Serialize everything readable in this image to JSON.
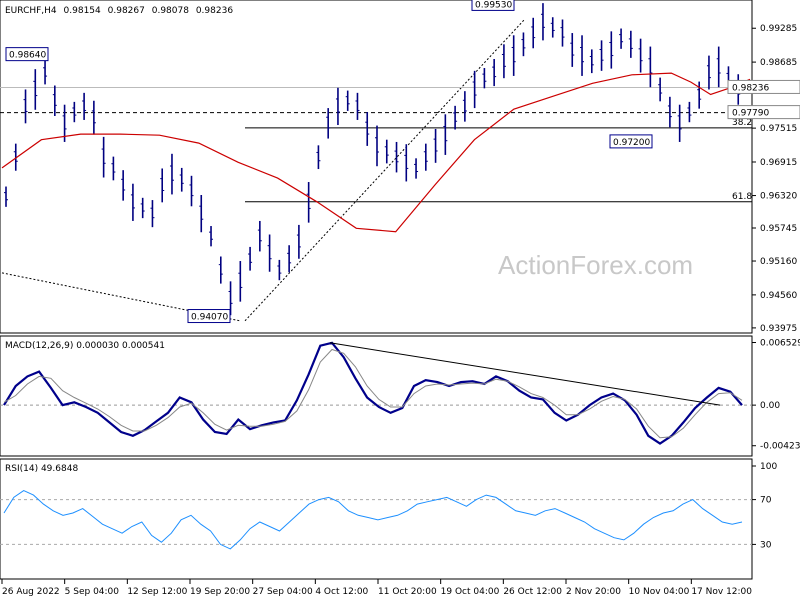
{
  "chart_data": [
    {
      "type": "line",
      "title": "EURCHF,H4",
      "ohlc": [
        "0.98154",
        "0.98267",
        "0.98078",
        "0.98236"
      ],
      "watermark": "ActionForex.com",
      "ylim": [
        0.9392,
        0.9975
      ],
      "yticks": [
        "0.99285",
        "0.98685",
        "0.98236",
        "0.97790",
        "0.97515",
        "0.96915",
        "0.96320",
        "0.95745",
        "0.95160",
        "0.94560",
        "0.93975"
      ],
      "ytick_values": [
        0.99285,
        0.98685,
        0.98236,
        0.9779,
        0.97515,
        0.96915,
        0.9632,
        0.95745,
        0.9516,
        0.9456,
        0.93975
      ],
      "current_price_label": "0.98236",
      "hline_label": "0.97790",
      "current_price": 0.98236,
      "hline_value": 0.9779,
      "fib_levels": [
        {
          "label": "38.2",
          "value": 0.9752
        },
        {
          "label": "61.8",
          "value": 0.9621
        }
      ],
      "annotations": [
        {
          "label": "0.98640",
          "value": 0.9864,
          "bar": 48
        },
        {
          "label": "0.99530",
          "value": 0.9953,
          "bar": 420
        },
        {
          "label": "0.94070",
          "value": 0.9407,
          "bar": 194
        },
        {
          "label": "0.97200",
          "value": 0.972,
          "bar": 538
        }
      ],
      "series": [
        {
          "name": "",
          "color": "#cc0000",
          "values": [
            0.9681,
            0.9731,
            0.9741,
            0.9741,
            0.9739,
            0.9725,
            0.9691,
            0.9663,
            0.9621,
            0.9574,
            0.9568,
            0.9651,
            0.9731,
            0.9785,
            0.9808,
            0.9831,
            0.9846,
            0.9849,
            0.9833,
            0.9811,
            0.9823,
            0.9838
          ]
        },
        {
          "name": "",
          "color": "#000000",
          "values": [
            0.9476,
            0.9407,
            0.9541,
            0.9586,
            0.9621,
            0.9666,
            0.9681,
            0.9701,
            0.9751,
            0.9795,
            0.9839,
            0.9885
          ]
        }
      ],
      "x": [
        0,
        40,
        80,
        120,
        160,
        200,
        240,
        280,
        320,
        360,
        400,
        440,
        480,
        520,
        560,
        600,
        640,
        680,
        700,
        720,
        740,
        760
      ],
      "candles": [
        0.963,
        0.97,
        0.979,
        0.982,
        0.985,
        0.98,
        0.976,
        0.978,
        0.979,
        0.977,
        0.97,
        0.968,
        0.965,
        0.962,
        0.961,
        0.96,
        0.965,
        0.967,
        0.966,
        0.964,
        0.96,
        0.956,
        0.95,
        0.945,
        0.948,
        0.952,
        0.956,
        0.953,
        0.95,
        0.952,
        0.955,
        0.962,
        0.97,
        0.976,
        0.979,
        0.98,
        0.979,
        0.975,
        0.972,
        0.971,
        0.97,
        0.969,
        0.968,
        0.97,
        0.972,
        0.974,
        0.977,
        0.979,
        0.982,
        0.984,
        0.985,
        0.987,
        0.988,
        0.99,
        0.992,
        0.994,
        0.993,
        0.992,
        0.989,
        0.988,
        0.987,
        0.988,
        0.989,
        0.991,
        0.99,
        0.988,
        0.986,
        0.982,
        0.978,
        0.976,
        0.978,
        0.981,
        0.985,
        0.986,
        0.984,
        0.982
      ]
    },
    {
      "type": "line",
      "title": "MACD(12,26,9) 0.000030 0.000541",
      "ylim": [
        -0.0052,
        0.007
      ],
      "yticks": [
        "0.006529",
        "0.00",
        "-0.004233"
      ],
      "ytick_values": [
        0.006529,
        0.0,
        -0.004233
      ],
      "series": [
        {
          "name": "",
          "color": "#00008b",
          "values": [
            0.0,
            0.002,
            0.003,
            0.0035,
            0.0018,
            0.0,
            0.0003,
            -0.0002,
            -0.0008,
            -0.0018,
            -0.0028,
            -0.0032,
            -0.0026,
            -0.0017,
            -0.0008,
            0.0008,
            0.0003,
            -0.0015,
            -0.0028,
            -0.003,
            -0.0015,
            -0.0025,
            -0.0021,
            -0.0018,
            -0.0016,
            0.0005,
            0.0032,
            0.0062,
            0.0065,
            0.005,
            0.0028,
            0.0008,
            -0.0002,
            -0.0008,
            -0.0003,
            0.002,
            0.0026,
            0.0024,
            0.002,
            0.0024,
            0.0025,
            0.0022,
            0.003,
            0.0025,
            0.0015,
            0.0008,
            0.0006,
            -0.0008,
            -0.0016,
            -0.001,
            0.0,
            0.0008,
            0.0012,
            0.0005,
            -0.001,
            -0.0032,
            -0.004,
            -0.0032,
            -0.0018,
            -0.0003,
            0.0008,
            0.0018,
            0.0014,
            0.0
          ]
        },
        {
          "name": "",
          "color": "#888888",
          "values": [
            0.0003,
            0.001,
            0.0022,
            0.003,
            0.0028,
            0.0015,
            0.0008,
            0.0002,
            -0.0004,
            -0.0012,
            -0.0021,
            -0.0027,
            -0.0027,
            -0.0021,
            -0.0013,
            -0.0002,
            0.0002,
            -0.0008,
            -0.002,
            -0.0026,
            -0.0021,
            -0.0022,
            -0.0022,
            -0.002,
            -0.0017,
            -0.0006,
            0.0016,
            0.0045,
            0.0058,
            0.0054,
            0.004,
            0.002,
            0.0006,
            -0.0002,
            -0.0002,
            0.0012,
            0.002,
            0.0022,
            0.0021,
            0.0022,
            0.0023,
            0.0022,
            0.0027,
            0.0025,
            0.0019,
            0.0012,
            0.0008,
            0.0,
            -0.001,
            -0.001,
            -0.0004,
            0.0004,
            0.0009,
            0.0006,
            -0.0004,
            -0.0022,
            -0.0034,
            -0.0033,
            -0.0024,
            -0.001,
            0.0003,
            0.0012,
            0.0013,
            0.0005
          ]
        }
      ],
      "trendline": [
        [
          0.0065,
          0.0
        ]
      ]
    },
    {
      "type": "line",
      "title": "RSI(14) 49.6848",
      "ylim": [
        0,
        100
      ],
      "yticks": [
        "100",
        "70",
        "30"
      ],
      "ytick_values": [
        100,
        70,
        30
      ],
      "series": [
        {
          "name": "",
          "color": "#1e90ff",
          "values": [
            58,
            72,
            78,
            74,
            66,
            60,
            56,
            58,
            62,
            55,
            48,
            44,
            40,
            46,
            50,
            38,
            32,
            40,
            52,
            56,
            48,
            42,
            30,
            26,
            34,
            44,
            50,
            46,
            42,
            50,
            58,
            66,
            70,
            72,
            68,
            60,
            56,
            54,
            52,
            54,
            56,
            60,
            66,
            68,
            70,
            72,
            68,
            64,
            70,
            74,
            72,
            66,
            60,
            58,
            56,
            60,
            62,
            58,
            54,
            50,
            44,
            40,
            36,
            34,
            40,
            48,
            54,
            58,
            60,
            66,
            70,
            62,
            56,
            50,
            48,
            50
          ]
        }
      ]
    }
  ],
  "x_axis_labels": [
    "26 Aug 2022",
    "5 Sep 04:00",
    "12 Sep 12:00",
    "19 Sep 20:00",
    "27 Sep 04:00",
    "4 Oct 12:00",
    "11 Oct 20:00",
    "19 Oct 04:00",
    "26 Oct 12:00",
    "2 Nov 20:00",
    "10 Nov 04:00",
    "17 Nov 12:00"
  ],
  "colors": {
    "candle": "#000080",
    "ma": "#cc0000",
    "macd": "#00008b",
    "signal": "#999999",
    "rsi": "#1e90ff",
    "fib": "#000000",
    "label_border": "#00008b"
  }
}
